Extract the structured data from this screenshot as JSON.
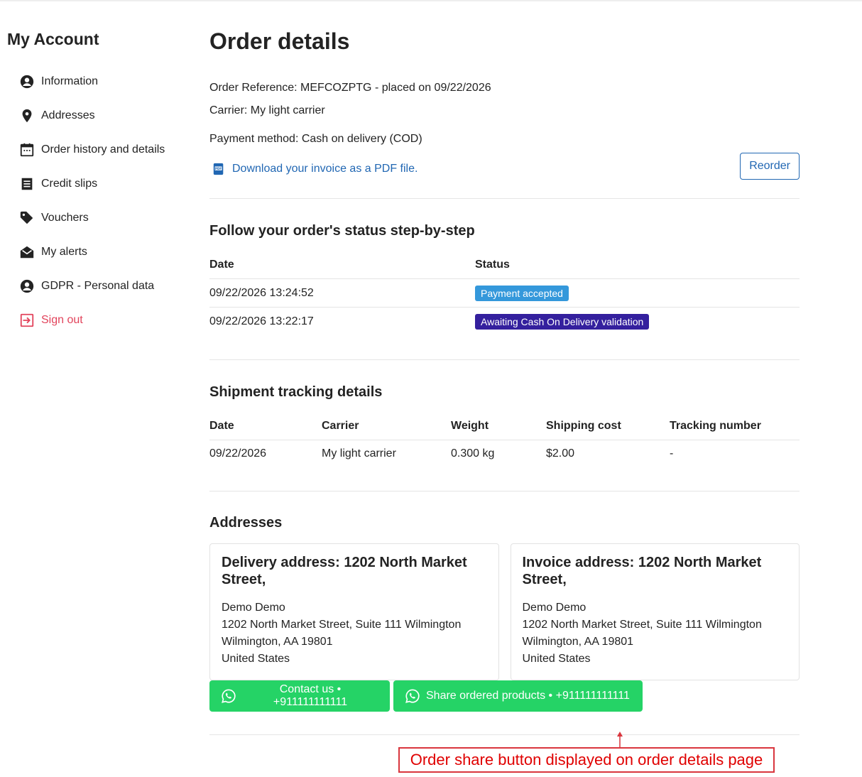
{
  "sidebar": {
    "title": "My Account",
    "items": [
      {
        "label": "Information"
      },
      {
        "label": "Addresses"
      },
      {
        "label": "Order history and details"
      },
      {
        "label": "Credit slips"
      },
      {
        "label": "Vouchers"
      },
      {
        "label": "My alerts"
      },
      {
        "label": "GDPR - Personal data"
      },
      {
        "label": "Sign out"
      }
    ]
  },
  "order": {
    "title": "Order details",
    "reference_line": "Order Reference: MEFCOZPTG - placed on 09/22/2026",
    "carrier_line": "Carrier: My light carrier",
    "payment_line": "Payment method: Cash on delivery (COD)",
    "invoice_link": "Download your invoice as a PDF file.",
    "reorder_label": "Reorder"
  },
  "status": {
    "title": "Follow your order's status step-by-step",
    "headers": {
      "date": "Date",
      "status": "Status"
    },
    "rows": [
      {
        "date": "09/22/2026 13:24:52",
        "status": "Payment accepted",
        "color": "#3498db"
      },
      {
        "date": "09/22/2026 13:22:17",
        "status": "Awaiting Cash On Delivery validation",
        "color": "#34209e"
      }
    ]
  },
  "tracking": {
    "title": "Shipment tracking details",
    "headers": {
      "date": "Date",
      "carrier": "Carrier",
      "weight": "Weight",
      "cost": "Shipping cost",
      "tracking": "Tracking number"
    },
    "rows": [
      {
        "date": "09/22/2026",
        "carrier": "My light carrier",
        "weight": "0.300 kg",
        "cost": "$2.00",
        "tracking": "-"
      }
    ]
  },
  "addresses": {
    "title": "Addresses",
    "delivery": {
      "heading": "Delivery address: 1202 North Market Street,",
      "name": "Demo Demo",
      "street": "1202 North Market Street, Suite 111 Wilmington",
      "city": "Wilmington, AA 19801",
      "country": "United States"
    },
    "invoice": {
      "heading": "Invoice address: 1202 North Market Street,",
      "name": "Demo Demo",
      "street": "1202 North Market Street, Suite 111 Wilmington",
      "city": "Wilmington, AA 19801",
      "country": "United States"
    }
  },
  "whatsapp": {
    "contact_label": "Contact us • +911111111111",
    "share_label": "Share ordered products • +911111111111",
    "color": "#25d366"
  },
  "annotation": {
    "text": "Order share button displayed on order details page"
  }
}
